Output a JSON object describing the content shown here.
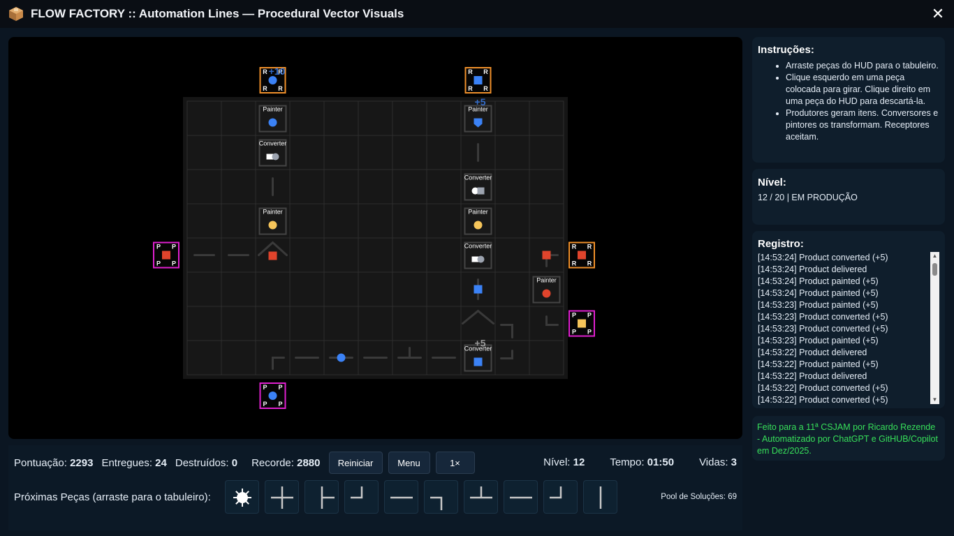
{
  "window": {
    "title": "FLOW FACTORY :: Automation Lines — Procedural Vector Visuals",
    "icon": "package-icon",
    "close_icon": "close-icon"
  },
  "colors": {
    "accent_blue": "#3b82f6",
    "red": "#e0442c",
    "yellow": "#f6c55a",
    "white": "#ffffff",
    "gray": "#9ca3af",
    "producer_border": "#e020d0",
    "receiver_border": "#f0902a",
    "credits": "#37e05a"
  },
  "board": {
    "grid": {
      "cols": 11,
      "rows": 8
    },
    "machines": [
      {
        "label": "Painter",
        "cell": [
          2,
          0
        ],
        "item": "blue-circle"
      },
      {
        "label": "Converter",
        "cell": [
          2,
          1
        ],
        "item": "white-square-gray-circle"
      },
      {
        "label": "Painter",
        "cell": [
          2,
          3
        ],
        "item": "yellow-circle"
      },
      {
        "label": "Painter",
        "cell": [
          8,
          0
        ],
        "item": "blue-shield"
      },
      {
        "label": "Converter",
        "cell": [
          8,
          2
        ],
        "item": "white-circle-gray-square"
      },
      {
        "label": "Painter",
        "cell": [
          8,
          3
        ],
        "item": "yellow-circle"
      },
      {
        "label": "Converter",
        "cell": [
          8,
          4
        ],
        "item": "white-square-gray-circle"
      },
      {
        "label": "Converter",
        "cell": [
          8,
          7
        ],
        "item": "blue-square"
      },
      {
        "label": "Painter",
        "cell": [
          10,
          5
        ],
        "item": "red-circle"
      }
    ],
    "floaters": [
      "+10",
      "+5",
      "+5"
    ],
    "endpoints": [
      {
        "kind": "receiver",
        "letter": "R",
        "item": "blue-circle"
      },
      {
        "kind": "receiver",
        "letter": "R",
        "item": "blue-square"
      },
      {
        "kind": "producer",
        "letter": "P",
        "item": "red-square"
      },
      {
        "kind": "receiver",
        "letter": "R",
        "item": "red-square"
      },
      {
        "kind": "producer",
        "letter": "P",
        "item": "yellow-square"
      },
      {
        "kind": "producer",
        "letter": "P",
        "item": "blue-circle"
      }
    ]
  },
  "instructions": {
    "title": "Instruções:",
    "items": [
      "Arraste peças do HUD para o tabuleiro.",
      "Clique esquerdo em uma peça colocada para girar. Clique direito em uma peça do HUD para descartá-la.",
      "Produtores geram itens. Conversores e pintores os transformam. Receptores aceitam."
    ]
  },
  "level_panel": {
    "title": "Nível:",
    "value": "12 / 20 | EM PRODUÇÃO"
  },
  "log": {
    "title": "Registro:",
    "entries": [
      "[14:53:24] Product converted (+5)",
      "[14:53:24] Product delivered",
      "[14:53:24] Product painted (+5)",
      "[14:53:24] Product painted (+5)",
      "[14:53:23] Product painted (+5)",
      "[14:53:23] Product converted (+5)",
      "[14:53:23] Product converted (+5)",
      "[14:53:23] Product painted (+5)",
      "[14:53:22] Product delivered",
      "[14:53:22] Product painted (+5)",
      "[14:53:22] Product delivered",
      "[14:53:22] Product converted (+5)",
      "[14:53:22] Product converted (+5)"
    ]
  },
  "credits": "Feito para a 11ª CSJAM por Ricardo Rezende - Automatizado por ChatGPT e GitHUB/Copilot em Dez/2025.",
  "hud": {
    "score_label": "Pontuação:",
    "score": "2293",
    "delivered_label": "Entregues:",
    "delivered": "24",
    "destroyed_label": "Destruídos:",
    "destroyed": "0",
    "record_label": "Recorde:",
    "record": "2880",
    "restart_button": "Reiniciar",
    "menu_button": "Menu",
    "speed_button": "1×",
    "level_label": "Nível:",
    "level": "12",
    "time_label": "Tempo:",
    "time": "01:50",
    "lives_label": "Vidas:",
    "lives": "3",
    "next_pieces_label": "Próximas Peças (arraste para o tabuleiro):",
    "pool_label": "Pool de Soluções: 69",
    "next_pieces": [
      "bomb-icon",
      "cross-piece",
      "tee-right-piece",
      "corner-up-left-piece",
      "straight-horizontal-piece",
      "corner-down-right-piece",
      "tee-up-piece",
      "straight-horizontal-piece",
      "corner-up-left-piece",
      "straight-vertical-piece"
    ]
  }
}
